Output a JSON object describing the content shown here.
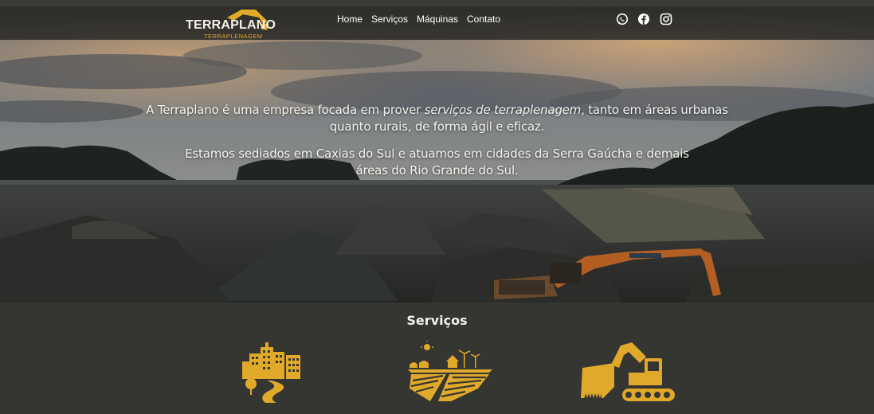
{
  "header": {
    "logo_text": "TERRAPLANO",
    "logo_sub": "TERRAPLENAGEM",
    "nav": [
      {
        "label": "Home"
      },
      {
        "label": "Serviços"
      },
      {
        "label": "Máquinas"
      },
      {
        "label": "Contato"
      }
    ],
    "social": [
      "whatsapp-icon",
      "facebook-icon",
      "instagram-icon"
    ]
  },
  "hero": {
    "p1_before": "A Terraplano é uma empresa focada em prover ",
    "p1_em": "serviços de terraplenagem",
    "p1_after": ", tanto em áreas urbanas quanto rurais, de forma ágil e eficaz.",
    "p2": "Estamos sediados em Caxias do Sul e atuamos em cidades da Serra Gaúcha e demais áreas do Rio Grande do Sul."
  },
  "services": {
    "title": "Serviços",
    "items": [
      {
        "icon": "urban-city-road-icon"
      },
      {
        "icon": "rural-farm-fields-icon"
      },
      {
        "icon": "excavator-icon"
      }
    ]
  },
  "colors": {
    "accent": "#e0a92a",
    "dark_bg": "#353531",
    "text_light": "#f3f1ec"
  }
}
